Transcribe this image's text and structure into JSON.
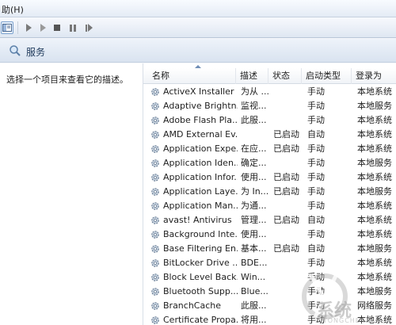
{
  "menubar": {
    "help_label": "助(H)"
  },
  "toolbar": {
    "buttons": [
      "console-tree-button",
      "start-button",
      "stop-button",
      "pause-button",
      "restart-button"
    ]
  },
  "header": {
    "title": "服务"
  },
  "description_pane": {
    "text": "选择一个项目来查看它的描述。"
  },
  "columns": {
    "name": "名称",
    "description": "描述",
    "status": "状态",
    "startup": "启动类型",
    "logon": "登录为"
  },
  "services": [
    {
      "name": "ActiveX Installer ...",
      "description": "为从 ...",
      "status": "",
      "startup": "手动",
      "logon": "本地系统"
    },
    {
      "name": "Adaptive Brightn...",
      "description": "监视...",
      "status": "",
      "startup": "手动",
      "logon": "本地服务"
    },
    {
      "name": "Adobe Flash Pla...",
      "description": "此服...",
      "status": "",
      "startup": "手动",
      "logon": "本地系统"
    },
    {
      "name": "AMD External Ev...",
      "description": "",
      "status": "已启动",
      "startup": "自动",
      "logon": "本地系统"
    },
    {
      "name": "Application Expe...",
      "description": "在应...",
      "status": "已启动",
      "startup": "手动",
      "logon": "本地系统"
    },
    {
      "name": "Application Iden...",
      "description": "确定...",
      "status": "",
      "startup": "手动",
      "logon": "本地服务"
    },
    {
      "name": "Application Infor...",
      "description": "使用...",
      "status": "已启动",
      "startup": "手动",
      "logon": "本地系统"
    },
    {
      "name": "Application Laye...",
      "description": "为 In...",
      "status": "已启动",
      "startup": "手动",
      "logon": "本地服务"
    },
    {
      "name": "Application Man...",
      "description": "为通...",
      "status": "",
      "startup": "手动",
      "logon": "本地系统"
    },
    {
      "name": "avast! Antivirus",
      "description": "管理...",
      "status": "已启动",
      "startup": "自动",
      "logon": "本地系统"
    },
    {
      "name": "Background Inte...",
      "description": "使用...",
      "status": "",
      "startup": "手动",
      "logon": "本地系统"
    },
    {
      "name": "Base Filtering En...",
      "description": "基本...",
      "status": "已启动",
      "startup": "自动",
      "logon": "本地服务"
    },
    {
      "name": "BitLocker Drive ...",
      "description": "BDE...",
      "status": "",
      "startup": "手动",
      "logon": "本地系统"
    },
    {
      "name": "Block Level Back...",
      "description": "Win...",
      "status": "",
      "startup": "手动",
      "logon": "本地系统"
    },
    {
      "name": "Bluetooth Supp...",
      "description": "Blue...",
      "status": "",
      "startup": "手动",
      "logon": "本地服务"
    },
    {
      "name": "BranchCache",
      "description": "此服...",
      "status": "",
      "startup": "手动",
      "logon": "网络服务"
    },
    {
      "name": "Certificate Propa...",
      "description": "将用...",
      "status": "",
      "startup": "手动",
      "logon": "本地系统"
    }
  ],
  "watermark": {
    "text": "系统",
    "sub": "XITONGCHENG"
  }
}
